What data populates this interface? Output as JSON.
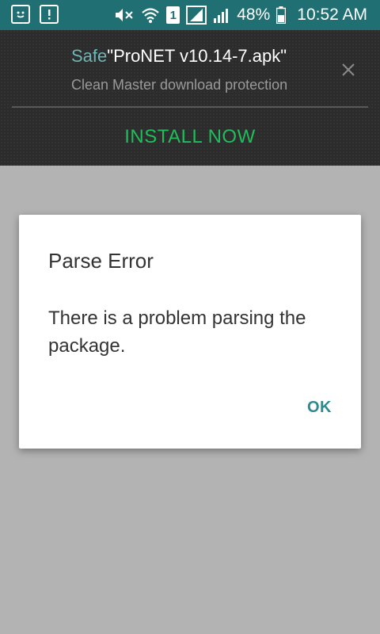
{
  "status_bar": {
    "left_icons": [
      "smiley-notification-icon",
      "alert-notification-icon"
    ],
    "right_icons": [
      "mute-icon",
      "wifi-icon",
      "sim-1-icon",
      "signal-1-icon",
      "signal-2-icon",
      "battery-icon"
    ],
    "sim_label": "1",
    "battery_percent": "48%",
    "time": "10:52 AM"
  },
  "banner": {
    "title_prefix": "Safe",
    "title_file": "\"ProNET v10.14-7.apk\"",
    "subtitle": "Clean Master download protection",
    "close_icon": "close-icon",
    "install_label": "INSTALL NOW",
    "install_color": "#1fbd5b"
  },
  "dialog": {
    "title": "Parse Error",
    "message": "There is a problem parsing the package.",
    "ok_label": "OK",
    "accent_color": "#2c8a91"
  },
  "colors": {
    "status_bar_bg": "#1f6f73",
    "scrim": "#b3b3b3",
    "banner_bg": "#2c2c2c"
  }
}
